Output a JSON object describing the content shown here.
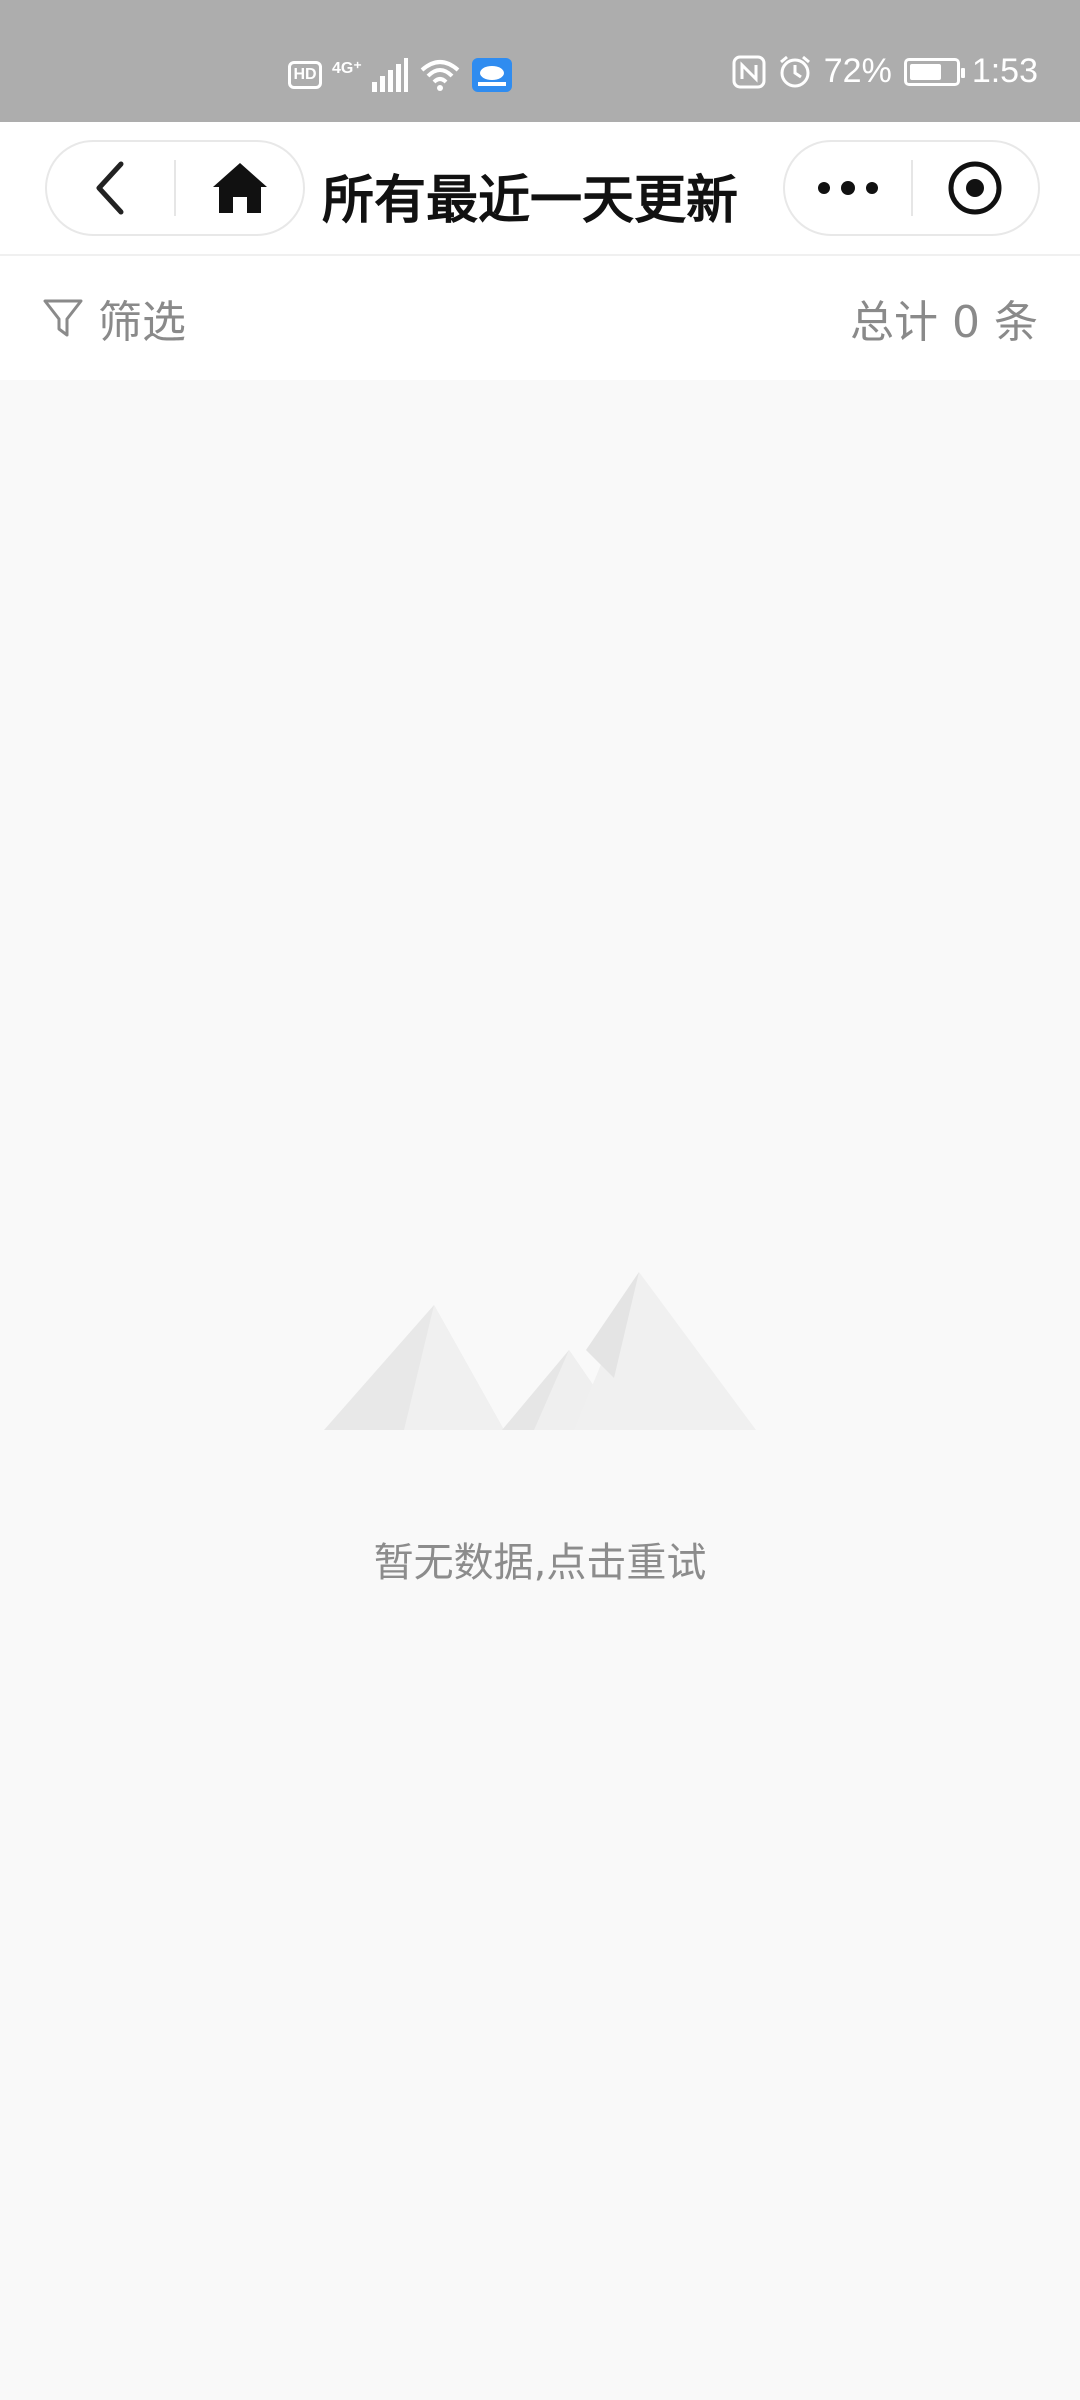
{
  "status_bar": {
    "hd_badge": "HD",
    "network_type": "4G⁺",
    "battery_percent": "72%",
    "battery_level": 0.72,
    "time": "1:53"
  },
  "nav": {
    "title": "所有最近一天更新",
    "back_icon": "chevron-left-icon",
    "home_icon": "home-icon",
    "more_icon": "more-dots-icon",
    "close_icon": "target-circle-icon"
  },
  "filter_bar": {
    "filter_label": "筛选",
    "total_count_text": "总计 0 条"
  },
  "empty_state": {
    "icon": "mountains-icon",
    "message": "暂无数据,点击重试"
  },
  "colors": {
    "status_bar_bg": "#adadad",
    "page_bg": "#f9f9f9",
    "muted_text": "#8a8a8a"
  }
}
